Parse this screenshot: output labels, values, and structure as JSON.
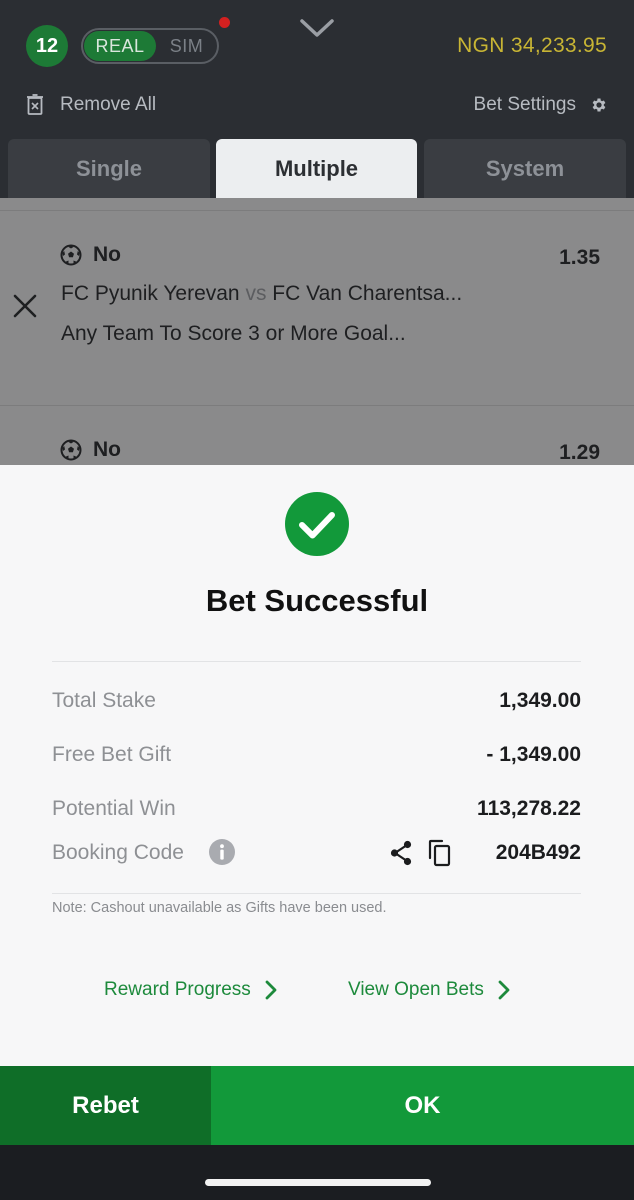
{
  "header": {
    "selections_count": "12",
    "mode_real_label": "REAL",
    "mode_sim_label": "SIM",
    "balance": "NGN 34,233.95",
    "remove_all_label": "Remove All",
    "bet_settings_label": "Bet Settings"
  },
  "tabs": [
    {
      "label": "Single",
      "active": false
    },
    {
      "label": "Multiple",
      "active": true
    },
    {
      "label": "System",
      "active": false
    }
  ],
  "selections": [
    {
      "pick": "No",
      "odds": "1.35",
      "home_team": "FC Pyunik Yerevan",
      "vs": "vs",
      "away_team": "FC Van Charentsa...",
      "market": "Any Team To Score 3 or More Goal..."
    },
    {
      "pick": "No",
      "odds": "1.29"
    }
  ],
  "modal": {
    "title": "Bet Successful",
    "rows": {
      "total_stake": {
        "label": "Total Stake",
        "value": "1,349.00"
      },
      "free_bet_gift": {
        "label": "Free Bet Gift",
        "value": "- 1,349.00"
      },
      "potential_win": {
        "label": "Potential Win",
        "value": "113,278.22"
      },
      "booking_code": {
        "label": "Booking Code",
        "value": "204B492"
      }
    },
    "note": "Note: Cashout unavailable as Gifts have been used.",
    "reward_progress_label": "Reward Progress",
    "view_open_bets_label": "View Open Bets"
  },
  "footer": {
    "rebet_label": "Rebet",
    "ok_label": "OK"
  },
  "colors": {
    "accent_green": "#12993a",
    "dark_green": "#0f6e28",
    "balance_gold": "#c8b534",
    "header_bg": "#2b2e33",
    "link_green": "#1d8a3c"
  }
}
